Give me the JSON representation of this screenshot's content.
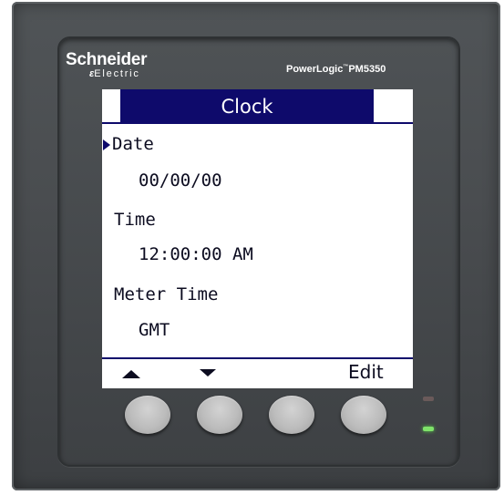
{
  "device": {
    "brand_line1": "Schneider",
    "brand_line2": "Electric",
    "model_prefix": "PowerLogic",
    "model_tm": "™",
    "model_suffix": "PM5350"
  },
  "screen": {
    "title": "Clock",
    "rows": [
      {
        "label": "Date",
        "selected": true
      },
      {
        "value": "00/00/00"
      },
      {
        "label": "Time"
      },
      {
        "value": "12:00:00 AM"
      },
      {
        "label": "Meter Time"
      },
      {
        "value": "GMT"
      }
    ],
    "softkeys": {
      "key1_icon": "up-arrow-icon",
      "key2_icon": "down-arrow-icon",
      "key4_label": "Edit"
    }
  },
  "hardware_buttons": [
    "softkey-button-1",
    "softkey-button-2",
    "softkey-button-3",
    "softkey-button-4"
  ],
  "leds": {
    "alarm": "off",
    "heartbeat": "on"
  },
  "colors": {
    "screen_accent": "#0e0a6b",
    "case": "#4a4d50",
    "led_green": "#7fe36a"
  }
}
